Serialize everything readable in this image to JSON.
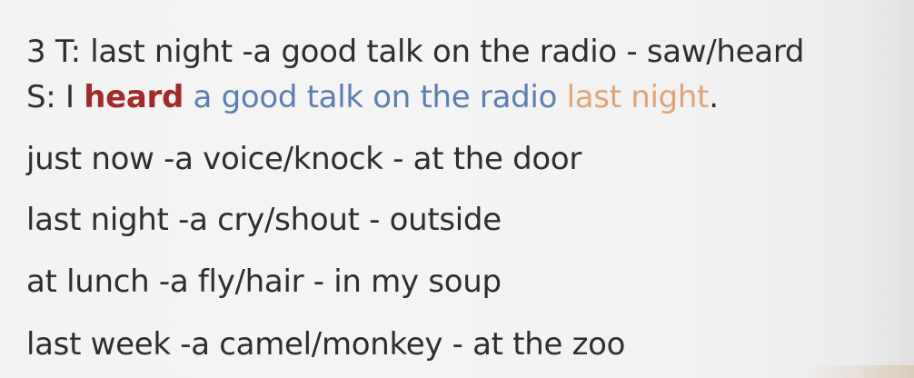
{
  "exercise": {
    "prompt_line": "3 T: last night -a good talk on the radio - saw/heard",
    "answer": {
      "prefix": "S: I ",
      "verb": "heard",
      "object": "a good talk on the radio",
      "time": "last night",
      "end": "."
    },
    "items": [
      "just now -a voice/knock - at the door",
      "last night -a cry/shout - outside",
      "at lunch -a fly/hair - in my soup",
      "last week -a camel/monkey - at the zoo"
    ],
    "colors": {
      "text": "#2e2e2e",
      "verb": "#a3292b",
      "object": "#5b7fb0",
      "time": "#e0a478"
    }
  }
}
